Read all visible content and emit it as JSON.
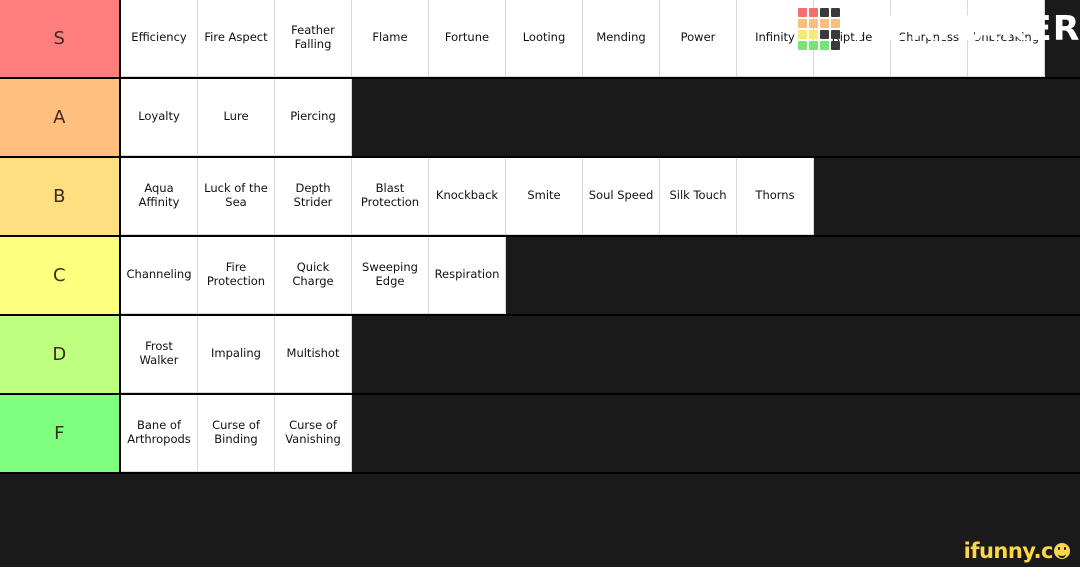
{
  "brand": {
    "name": "TiERMAKER",
    "grid_colors": [
      "#f4706e",
      "#f4706e",
      "#3a3a3a",
      "#3a3a3a",
      "#f9bd7d",
      "#f9bd7d",
      "#f9bd7d",
      "#f9bd7d",
      "#f4ec72",
      "#f4ec72",
      "#3a3a3a",
      "#3a3a3a",
      "#78e478",
      "#78e478",
      "#78e478",
      "#3a3a3a"
    ]
  },
  "watermark": {
    "text": "ifunny.c",
    "icon": "smiley-face-icon"
  },
  "background_color": "#1a1a1a",
  "tiers": [
    {
      "label": "S",
      "color": "#ff7f7f",
      "items": [
        "Efficiency",
        "Fire Aspect",
        "Feather Falling",
        "Flame",
        "Fortune",
        "Looting",
        "Mending",
        "Power",
        "Infinity",
        "Riptide",
        "Sharpness",
        "Unbreaking"
      ]
    },
    {
      "label": "A",
      "color": "#ffbf7f",
      "items": [
        "Loyalty",
        "Lure",
        "Piercing"
      ]
    },
    {
      "label": "B",
      "color": "#ffdf80",
      "items": [
        "Aqua Affinity",
        "Luck of the Sea",
        "Depth Strider",
        "Blast Protection",
        "Knockback",
        "Smite",
        "Soul Speed",
        "Silk Touch",
        "Thorns"
      ]
    },
    {
      "label": "C",
      "color": "#ffff7f",
      "items": [
        "Channeling",
        "Fire Protection",
        "Quick Charge",
        "Sweeping Edge",
        "Respiration"
      ]
    },
    {
      "label": "D",
      "color": "#bfff7f",
      "items": [
        "Frost Walker",
        "Impaling",
        "Multishot"
      ]
    },
    {
      "label": "F",
      "color": "#7fff7f",
      "items": [
        "Bane of Arthropods",
        "Curse of Binding",
        "Curse of Vanishing"
      ]
    }
  ]
}
